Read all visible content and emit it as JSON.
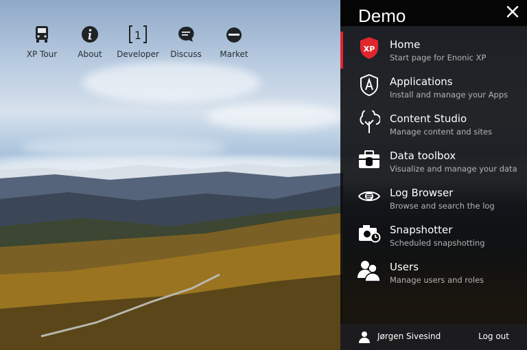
{
  "launcher": {
    "items": [
      {
        "label": "XP Tour",
        "icon": "bus-icon"
      },
      {
        "label": "About",
        "icon": "info-icon"
      },
      {
        "label": "Developer",
        "icon": "bracket-one-icon"
      },
      {
        "label": "Discuss",
        "icon": "chat-bubble-icon"
      },
      {
        "label": "Market",
        "icon": "shopping-bag-icon"
      }
    ]
  },
  "panel": {
    "title": "Demo",
    "menu": [
      {
        "title": "Home",
        "subtitle": "Start page for Enonic XP",
        "icon": "xp-shield-icon",
        "active": true
      },
      {
        "title": "Applications",
        "subtitle": "Install and manage your Apps",
        "icon": "applications-icon",
        "active": false
      },
      {
        "title": "Content Studio",
        "subtitle": "Manage content and sites",
        "icon": "tree-icon",
        "active": false
      },
      {
        "title": "Data toolbox",
        "subtitle": "Visualize and manage your data",
        "icon": "toolbox-icon",
        "active": false
      },
      {
        "title": "Log Browser",
        "subtitle": "Browse and search the log",
        "icon": "eye-icon",
        "active": false
      },
      {
        "title": "Snapshotter",
        "subtitle": "Scheduled snapshotting",
        "icon": "camera-clock-icon",
        "active": false
      },
      {
        "title": "Users",
        "subtitle": "Manage users and roles",
        "icon": "users-icon",
        "active": false
      }
    ],
    "footer": {
      "user_name": "Jørgen Sivesind",
      "logout_label": "Log out"
    }
  },
  "colors": {
    "active_accent": "#e0262e",
    "xp_badge": "#e0262e",
    "panel_bg": "#0a0a0c"
  }
}
